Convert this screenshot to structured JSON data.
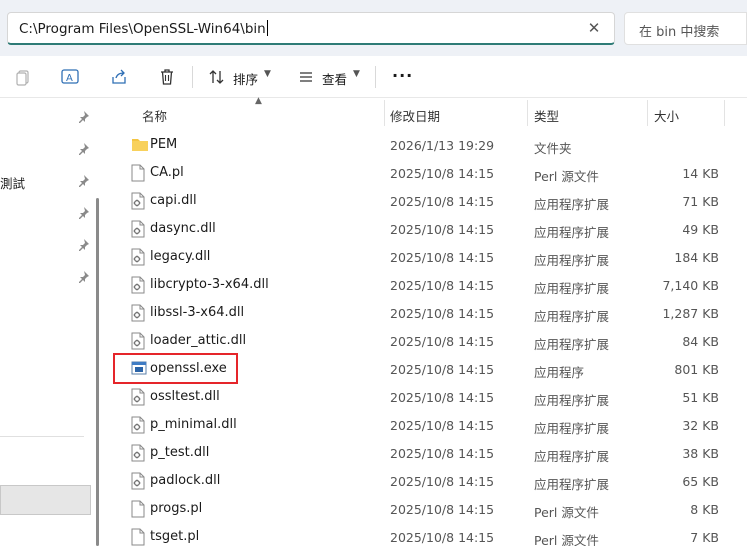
{
  "address": {
    "path": "C:\\Program Files\\OpenSSL-Win64\\bin"
  },
  "search": {
    "placeholder": "在 bin 中搜索"
  },
  "toolbar": {
    "sort_label": "排序",
    "view_label": "查看"
  },
  "sidebar": {
    "partial_label": "測試"
  },
  "columns": {
    "name": "名称",
    "date": "修改日期",
    "type": "类型",
    "size": "大小"
  },
  "files": [
    {
      "name": "PEM",
      "date": "2026/1/13 19:29",
      "type": "文件夹",
      "size": "",
      "icon": "folder-icon"
    },
    {
      "name": "CA.pl",
      "date": "2025/10/8 14:15",
      "type": "Perl 源文件",
      "size": "14 KB",
      "icon": "file-icon"
    },
    {
      "name": "capi.dll",
      "date": "2025/10/8 14:15",
      "type": "应用程序扩展",
      "size": "71 KB",
      "icon": "dll-icon"
    },
    {
      "name": "dasync.dll",
      "date": "2025/10/8 14:15",
      "type": "应用程序扩展",
      "size": "49 KB",
      "icon": "dll-icon"
    },
    {
      "name": "legacy.dll",
      "date": "2025/10/8 14:15",
      "type": "应用程序扩展",
      "size": "184 KB",
      "icon": "dll-icon"
    },
    {
      "name": "libcrypto-3-x64.dll",
      "date": "2025/10/8 14:15",
      "type": "应用程序扩展",
      "size": "7,140 KB",
      "icon": "dll-icon"
    },
    {
      "name": "libssl-3-x64.dll",
      "date": "2025/10/8 14:15",
      "type": "应用程序扩展",
      "size": "1,287 KB",
      "icon": "dll-icon"
    },
    {
      "name": "loader_attic.dll",
      "date": "2025/10/8 14:15",
      "type": "应用程序扩展",
      "size": "84 KB",
      "icon": "dll-icon"
    },
    {
      "name": "openssl.exe",
      "date": "2025/10/8 14:15",
      "type": "应用程序",
      "size": "801 KB",
      "icon": "exe-icon"
    },
    {
      "name": "ossltest.dll",
      "date": "2025/10/8 14:15",
      "type": "应用程序扩展",
      "size": "51 KB",
      "icon": "dll-icon"
    },
    {
      "name": "p_minimal.dll",
      "date": "2025/10/8 14:15",
      "type": "应用程序扩展",
      "size": "32 KB",
      "icon": "dll-icon"
    },
    {
      "name": "p_test.dll",
      "date": "2025/10/8 14:15",
      "type": "应用程序扩展",
      "size": "38 KB",
      "icon": "dll-icon"
    },
    {
      "name": "padlock.dll",
      "date": "2025/10/8 14:15",
      "type": "应用程序扩展",
      "size": "65 KB",
      "icon": "dll-icon"
    },
    {
      "name": "progs.pl",
      "date": "2025/10/8 14:15",
      "type": "Perl 源文件",
      "size": "8 KB",
      "icon": "file-icon"
    },
    {
      "name": "tsget.pl",
      "date": "2025/10/8 14:15",
      "type": "Perl 源文件",
      "size": "7 KB",
      "icon": "file-icon"
    }
  ],
  "colors": {
    "accent": "#2e7b76",
    "highlight": "#e5252a",
    "folder": "#f4c542"
  }
}
